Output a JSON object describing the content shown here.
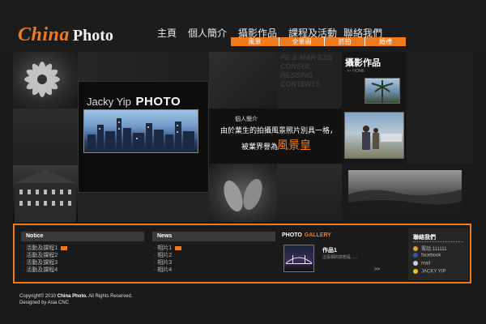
{
  "logo": {
    "part1": "China",
    "part2": "Photo"
  },
  "nav": {
    "items": [
      "主頁",
      "個人簡介",
      "攝影作品",
      "課程及活動",
      "聯絡我們"
    ],
    "sub_items": [
      "風景",
      "全景圖",
      "抓拍",
      "婚禮"
    ]
  },
  "gallery": {
    "ghost_text": "PE & MAR ESS CONSUL RESSING CONTENTS",
    "jacky_title": "Jacky Yip",
    "jacky_title_bold": "PHOTO",
    "photo_title": "攝影作品",
    "photo_home": ">> HOME",
    "intro_label": "個人簡介",
    "intro_line1": "由於業生的拍攝風景照片別具一格，",
    "intro_line2": "被業界譽為",
    "intro_highlight": "風景皇"
  },
  "notice": {
    "heading": "Notice",
    "items": [
      "活動及課程1",
      "活動及課程2",
      "活動及課程3",
      "活動及課程4"
    ]
  },
  "news": {
    "heading": "News",
    "items": [
      "相片1",
      "相片2",
      "相片3",
      "相片4"
    ]
  },
  "photo_gallery": {
    "heading": "PHOTO",
    "heading_accent": "GALLERY",
    "item_title": "作品1",
    "item_desc": "這張相的感想是......",
    "more": ">>"
  },
  "contact": {
    "heading": "聯絡我們",
    "rows": [
      {
        "icon": "phone-icon",
        "text": "電話:111111",
        "color": "#e0a030"
      },
      {
        "icon": "facebook-icon",
        "text": "facebook",
        "color": "#3b5998"
      },
      {
        "icon": "mail-icon",
        "text": "mail",
        "color": "#d0d0d0"
      },
      {
        "icon": "user-icon",
        "text": "JACKY YIP",
        "color": "#e8c020"
      }
    ]
  },
  "footer": {
    "copyright_prefix": "Copyright© 2010",
    "copyright_name": "China Photo.",
    "copyright_suffix": "All Rights Reserved.",
    "designed": "Designed by Asia CNC"
  },
  "colors": {
    "accent": "#f07a1e",
    "background": "#1a1a1a"
  }
}
